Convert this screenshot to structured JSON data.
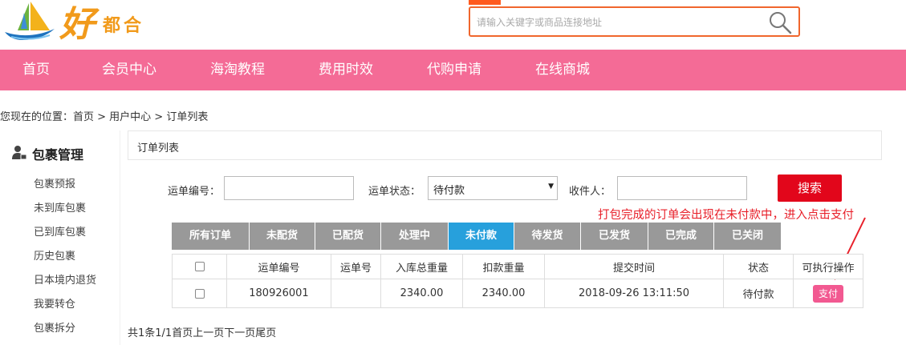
{
  "header": {
    "logo_big": "好",
    "logo_small": "都合",
    "search_placeholder": "请输入关键字或商品连接地址"
  },
  "nav": {
    "items": [
      "首页",
      "会员中心",
      "海淘教程",
      "费用时效",
      "代购申请",
      "在线商城"
    ]
  },
  "breadcrumb": "您现在的位置：首页 > 用户中心 > 订单列表",
  "sidebar": {
    "title": "包裹管理",
    "items": [
      "包裹预报",
      "未到库包裹",
      "已到库包裹",
      "历史包裹",
      "日本境内退货",
      "我要转仓",
      "包裹拆分"
    ]
  },
  "panel": {
    "title": "订单列表"
  },
  "filter": {
    "order_no_label": "运单编号：",
    "status_label": "运单状态：",
    "status_value": "待付款",
    "recipient_label": "收件人：",
    "search_button": "搜索"
  },
  "annotation": "打包完成的订单会出现在未付款中，进入点击支付",
  "tabs": [
    "所有订单",
    "未配货",
    "已配货",
    "处理中",
    "未付款",
    "待发货",
    "已发货",
    "已完成",
    "已关闭"
  ],
  "active_tab": "未付款",
  "table": {
    "headers": [
      "运单编号",
      "运单号",
      "入库总重量",
      "扣款重量",
      "提交时间",
      "状态",
      "可执行操作"
    ],
    "rows": [
      {
        "order_no": "180926001",
        "waybill": "",
        "in_weight": "2340.00",
        "charge_weight": "2340.00",
        "submit_time": "2018-09-26 13:11:50",
        "status": "待付款",
        "action": "支付"
      }
    ]
  },
  "pager": {
    "summary": "共1条1/1",
    "first": "首页",
    "prev": "上一页",
    "next": "下一页",
    "last": "尾页"
  },
  "colors": {
    "nav_bg": "#f46b96",
    "tab_active": "#27a0dc",
    "tab_default": "#999999",
    "search_btn": "#e2061b",
    "pay_btn": "#f25991",
    "annotation": "#e8202a",
    "search_border": "#f0662d"
  }
}
